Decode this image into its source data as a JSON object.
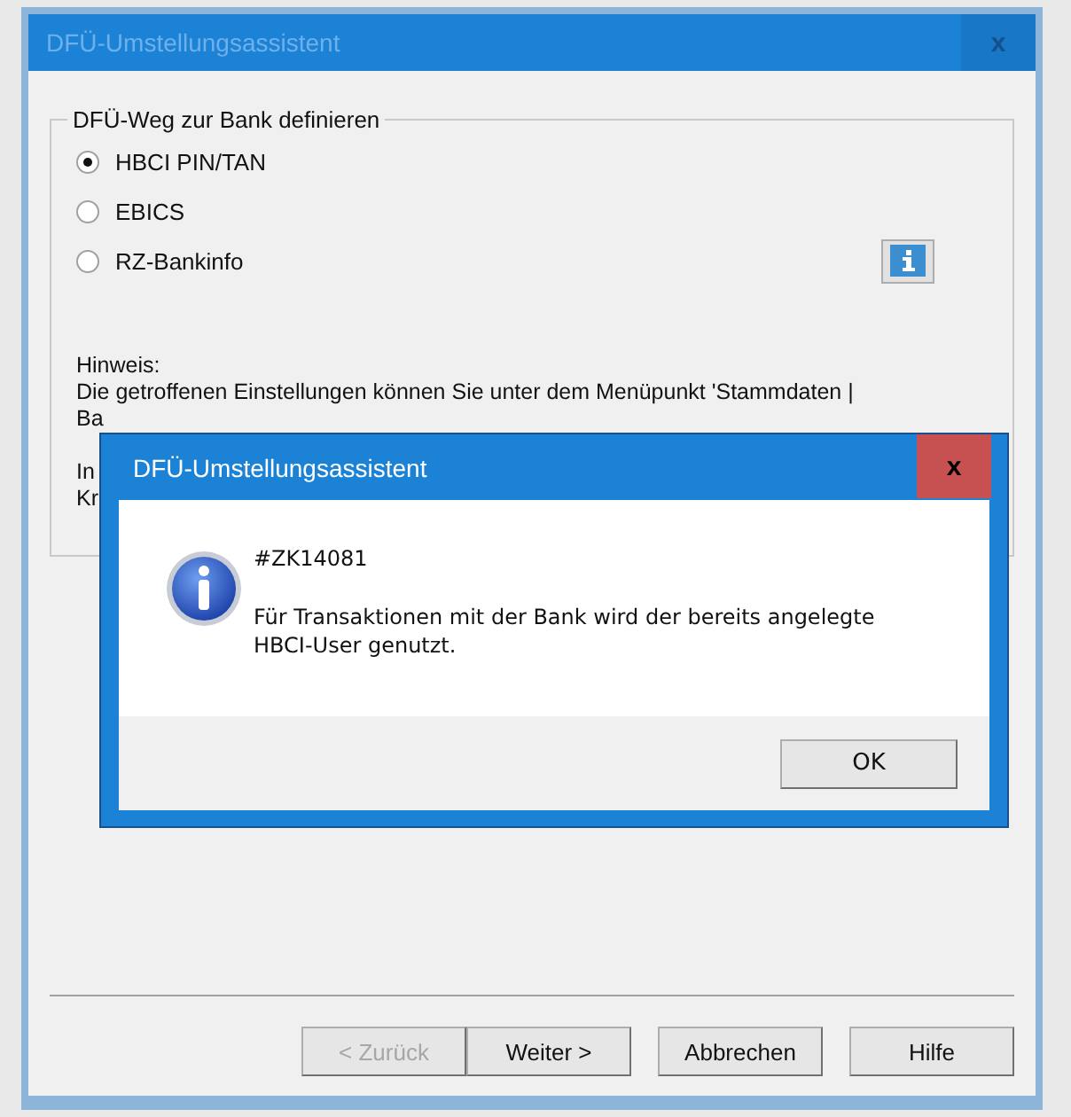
{
  "window": {
    "title": "DFÜ-Umstellungsassistent",
    "close": "x"
  },
  "group": {
    "title": "DFÜ-Weg zur Bank definieren",
    "options": [
      {
        "label": "HBCI PIN/TAN",
        "selected": true
      },
      {
        "label": "EBICS",
        "selected": false
      },
      {
        "label": "RZ-Bankinfo",
        "selected": false
      }
    ],
    "hint_lines": [
      "Hinweis:",
      "Die getroffenen Einstellungen können Sie unter dem Menüpunkt 'Stammdaten |",
      "Ba",
      "In",
      "Kr"
    ]
  },
  "buttons": [
    {
      "label": "< Zurück",
      "disabled": true
    },
    {
      "label": "Weiter >",
      "disabled": false
    },
    {
      "label": "Abbrechen",
      "disabled": false
    },
    {
      "label": "Hilfe",
      "disabled": false
    }
  ],
  "message_box": {
    "title": "DFÜ-Umstellungsassistent",
    "close": "x",
    "code": "#ZK14081",
    "message": "Für Transaktionen mit der Bank wird der bereits angelegte HBCI-User genutzt.",
    "ok": "OK"
  }
}
